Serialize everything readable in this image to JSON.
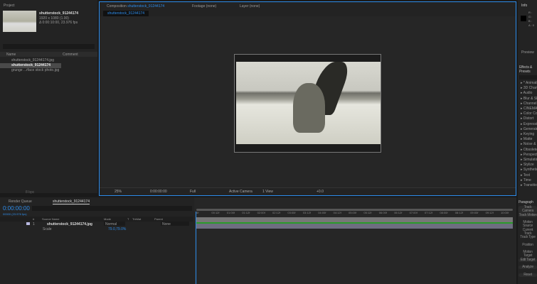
{
  "project": {
    "title": "Project",
    "comp_name": "shutterstock_91244174",
    "comp_size": "1920 x 1080 (1.00)",
    "comp_duration": "Δ 0:00:10:00, 23.976 fps",
    "col_name": "Name",
    "col_comment": "Comment",
    "items": [
      "shutterstock_91244174.jpg",
      "shutterstock_91244174",
      "grunge ...rface stock photo.jpg"
    ],
    "bpc": "8 bpc"
  },
  "comp": {
    "tab_label": "Composition",
    "tab_name": "shutterstock_91244174",
    "footage_tab": "Footage (none)",
    "layer_tab": "Layer (none)",
    "breadcrumb": "shutterstock_91244174",
    "zoom": "25%",
    "timecode": "0:00:00:00",
    "resolution": "Full",
    "camera": "Active Camera",
    "views": "1 View",
    "exposure": "+0.0"
  },
  "right": {
    "info": "Info",
    "r": "R :",
    "g": "G :",
    "b": "B :",
    "a": "A : 0",
    "preview": "Preview",
    "effects": "Effects & Presets",
    "effect_items": [
      "* Animation Presets",
      "3D Channel",
      "Audio",
      "Blur & Sharpen",
      "Channel",
      "CINEMA 4D",
      "Color Correction",
      "Distort",
      "Expression Controls",
      "Generate",
      "Keying",
      "Matte",
      "Noise & Grain",
      "Obsolete",
      "Perspective",
      "Simulation",
      "Stylize",
      "Synthetic Aperture",
      "Text",
      "Time",
      "Transition"
    ],
    "paragraph": "Paragraph",
    "tracker": [
      "Track Camera",
      "Track Motion",
      "Motion Source",
      "Current Track",
      "Track Type",
      "Position",
      "Motion Target",
      "Edit Target",
      "Analyze",
      "Reset"
    ]
  },
  "timeline": {
    "render_queue": "Render Queue",
    "comp_tab": "shutterstock_91244174",
    "timecode": "0:00:00:00",
    "fps": "00000 (23.976 fps)",
    "headers": {
      "num": "#",
      "source": "Source Name",
      "mode": "Mode",
      "t": "T",
      "trkmat": "TrkMat",
      "parent": "Parent"
    },
    "layer": {
      "num": "1",
      "name": "shutterstock_91244174.jpg",
      "mode": "Normal",
      "parent": "None"
    },
    "property": {
      "name": "Scale",
      "value": "79.0,79.0%"
    },
    "ticks": [
      "0f",
      "00:12f",
      "01:00f",
      "01:12f",
      "02:00f",
      "02:12f",
      "03:00f",
      "03:12f",
      "04:00f",
      "04:12f",
      "05:00f",
      "05:12f",
      "06:00f",
      "06:12f",
      "07:00f",
      "07:12f",
      "08:00f",
      "08:12f",
      "09:00f",
      "09:12f",
      "10:00f"
    ]
  },
  "colors": {
    "accent": "#2d8ceb",
    "layer_bar": "#6e6e80",
    "green": "#2a9a2a"
  }
}
